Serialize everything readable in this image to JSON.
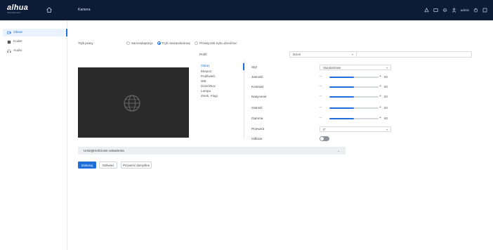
{
  "topbar": {
    "brand": "alhua",
    "brand_sub": "TECHNOLOGY",
    "title": "Kamera",
    "user": "admin",
    "icons": [
      "home-icon",
      "alarm-icon",
      "live-icon",
      "settings-icon",
      "user-icon",
      "logout-icon",
      "menu-icon"
    ]
  },
  "sidebar": {
    "items": [
      {
        "label": "Obraz",
        "icon": "camera-icon",
        "active": true
      },
      {
        "label": "Koder",
        "icon": "encoder-icon",
        "active": false
      },
      {
        "label": "Audio",
        "icon": "audio-icon",
        "active": false
      }
    ]
  },
  "mode": {
    "label": "Tryb pracy",
    "options": [
      {
        "label": "Samoadaptacja",
        "selected": false
      },
      {
        "label": "Tryb niestandardowy",
        "selected": true
      },
      {
        "label": "Przełącznik trybu dzień/noc",
        "selected": false
      }
    ]
  },
  "profile": {
    "label": "Profil",
    "value": "Dzień"
  },
  "menu": {
    "items": [
      {
        "label": "Obraz",
        "active": true
      },
      {
        "label": "Ekspoz.",
        "active": false
      },
      {
        "label": "Podświetl.",
        "active": false
      },
      {
        "label": "WB",
        "active": false
      },
      {
        "label": "Dzień/Noc",
        "active": false
      },
      {
        "label": "Lampa",
        "active": false
      },
      {
        "label": "Zniek. Flagi",
        "active": false
      }
    ]
  },
  "params": {
    "styl": {
      "label": "Styl",
      "value": "Standardowe"
    },
    "jasnosc": {
      "label": "Jasność",
      "value": 50
    },
    "kontrast": {
      "label": "Kontrast",
      "value": 50
    },
    "nasycenie": {
      "label": "Nasycenie",
      "value": 50
    },
    "ostrosc": {
      "label": "Ostrość",
      "value": 50
    },
    "gamma": {
      "label": "Gamma",
      "value": 50
    },
    "przewrot": {
      "label": "Przewrót",
      "value": "0°"
    },
    "odbicie": {
      "label": "Odbicie",
      "on": false
    }
  },
  "collapse": {
    "label": "Umiejętnościowe ustawienia"
  },
  "buttons": {
    "apply": "Zastosuj",
    "refresh": "Odśwież",
    "defaults": "Przywróć domyślne"
  },
  "colors": {
    "accent": "#1e6fd9",
    "topbar": "#0c1b36"
  }
}
